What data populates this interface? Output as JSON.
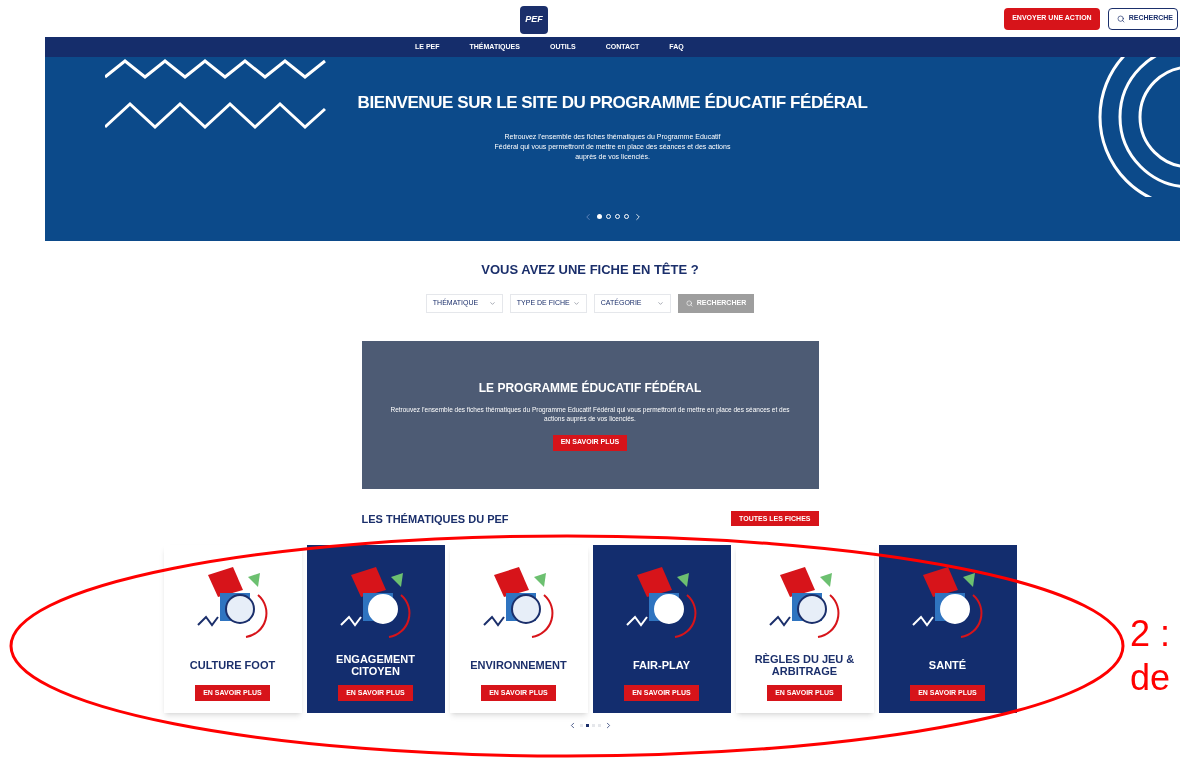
{
  "header": {
    "logo": "PEF",
    "cta_button": "ENVOYER UNE ACTION",
    "search_button": "RECHERCHE"
  },
  "nav": [
    "LE PEF",
    "THÉMATIQUES",
    "OUTILS",
    "CONTACT",
    "FAQ"
  ],
  "hero": {
    "title": "BIENVENUE SUR LE SITE DU PROGRAMME ÉDUCATIF FÉDÉRAL",
    "text": "Retrouvez l'ensemble des fiches thématiques du Programme Educatif Fédéral qui vous permettront de mettre en place des séances et des actions auprès de vos licenciés.",
    "slides": [
      {
        "selected": true
      },
      {
        "selected": false
      },
      {
        "selected": false
      },
      {
        "selected": false
      }
    ]
  },
  "search_section": {
    "title": "VOUS AVEZ UNE FICHE EN TÊTE ?",
    "filters": [
      {
        "placeholder": "THÉMATIQUE"
      },
      {
        "placeholder": "TYPE DE FICHE"
      },
      {
        "placeholder": "CATÉGORIE"
      }
    ],
    "button": "RECHERCHER"
  },
  "promo": {
    "title": "LE PROGRAMME ÉDUCATIF FÉDÉRAL",
    "text": "Retrouvez l'ensemble des fiches thématiques du Programme Educatif Fédéral qui vous permettront de mettre en place des séances et des actions auprès de vos licenciés.",
    "button": "EN SAVOIR PLUS"
  },
  "themes": {
    "title": "LES THÉMATIQUES DU PEF",
    "all_button": "TOUTES LES FICHES",
    "cards": [
      {
        "title": "CULTURE FOOT",
        "kind": "light",
        "button": "EN SAVOIR PLUS"
      },
      {
        "title": "ENGAGEMENT CITOYEN",
        "kind": "dark",
        "button": "EN SAVOIR PLUS"
      },
      {
        "title": "ENVIRONNEMENT",
        "kind": "light",
        "button": "EN SAVOIR PLUS"
      },
      {
        "title": "FAIR-PLAY",
        "kind": "dark",
        "button": "EN SAVOIR PLUS"
      },
      {
        "title": "RÈGLES DU JEU & ARBITRAGE",
        "kind": "light",
        "button": "EN SAVOIR PLUS"
      },
      {
        "title": "SANTÉ",
        "kind": "dark",
        "button": "EN SAVOIR PLUS"
      }
    ],
    "pages": [
      {
        "selected": false
      },
      {
        "selected": true
      },
      {
        "selected": false
      },
      {
        "selected": false
      }
    ]
  },
  "annotation": {
    "lines": [
      "2 :",
      "de"
    ]
  }
}
